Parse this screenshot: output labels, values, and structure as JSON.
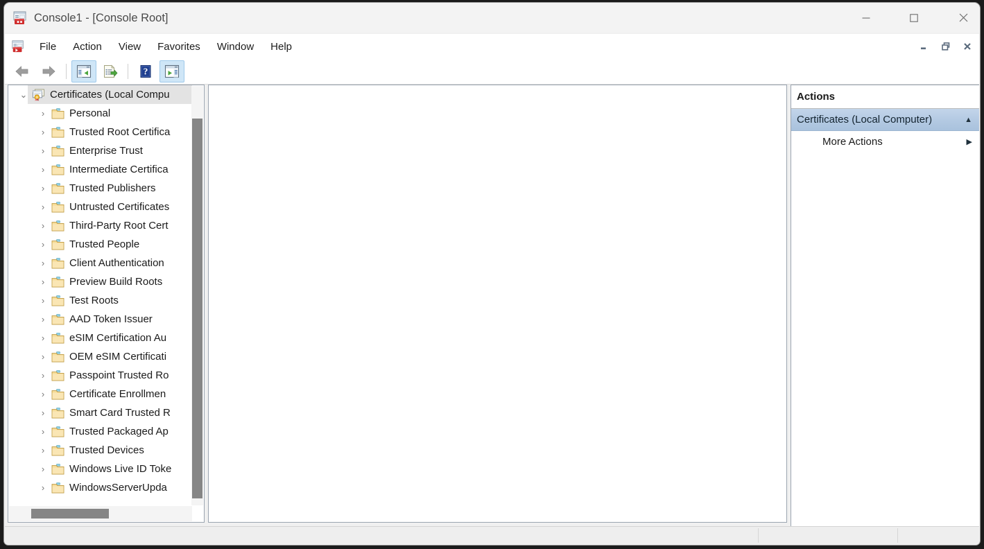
{
  "window": {
    "title": "Console1 - [Console Root]",
    "app_icon": "mmc-console-icon",
    "controls": {
      "minimize": "—",
      "maximize": "☐",
      "close": "✕"
    }
  },
  "menu": {
    "items": [
      {
        "label": "File",
        "name": "menu-file"
      },
      {
        "label": "Action",
        "name": "menu-action"
      },
      {
        "label": "View",
        "name": "menu-view"
      },
      {
        "label": "Favorites",
        "name": "menu-favorites"
      },
      {
        "label": "Window",
        "name": "menu-window"
      },
      {
        "label": "Help",
        "name": "menu-help"
      }
    ],
    "mdi_controls": {
      "minimize": "minimize-child-icon",
      "restore": "restore-child-icon",
      "close": "close-child-icon"
    }
  },
  "toolbar": {
    "buttons": [
      {
        "name": "back-button",
        "icon": "back-arrow-icon",
        "toggled": false
      },
      {
        "name": "forward-button",
        "icon": "forward-arrow-icon",
        "toggled": false
      },
      {
        "name": "show-hide-console-tree-button",
        "icon": "console-tree-icon",
        "toggled": true
      },
      {
        "name": "export-list-button",
        "icon": "export-list-icon",
        "toggled": false
      },
      {
        "name": "help-button",
        "icon": "help-question-icon",
        "toggled": false
      },
      {
        "name": "show-hide-action-pane-button",
        "icon": "action-pane-icon",
        "toggled": true
      }
    ]
  },
  "tree": {
    "root": {
      "label": "Certificates (Local Compu",
      "icon": "certificate-store-icon",
      "expanded": true,
      "selected": true,
      "twisty": "⌄"
    },
    "children": [
      {
        "label": "Personal",
        "icon": "folder-icon"
      },
      {
        "label": "Trusted Root Certifica",
        "icon": "folder-icon"
      },
      {
        "label": "Enterprise Trust",
        "icon": "folder-icon"
      },
      {
        "label": "Intermediate Certifica",
        "icon": "folder-icon"
      },
      {
        "label": "Trusted Publishers",
        "icon": "folder-icon"
      },
      {
        "label": "Untrusted Certificates",
        "icon": "folder-icon"
      },
      {
        "label": "Third-Party Root Cert",
        "icon": "folder-icon"
      },
      {
        "label": "Trusted People",
        "icon": "folder-icon"
      },
      {
        "label": "Client Authentication",
        "icon": "folder-icon"
      },
      {
        "label": "Preview Build Roots",
        "icon": "folder-icon"
      },
      {
        "label": "Test Roots",
        "icon": "folder-icon"
      },
      {
        "label": "AAD Token Issuer",
        "icon": "folder-icon"
      },
      {
        "label": "eSIM Certification Au",
        "icon": "folder-icon"
      },
      {
        "label": "OEM eSIM Certificati",
        "icon": "folder-icon"
      },
      {
        "label": "Passpoint Trusted Ro",
        "icon": "folder-icon"
      },
      {
        "label": "Certificate Enrollmen",
        "icon": "folder-icon"
      },
      {
        "label": "Smart Card Trusted R",
        "icon": "folder-icon"
      },
      {
        "label": "Trusted Packaged Ap",
        "icon": "folder-icon"
      },
      {
        "label": "Trusted Devices",
        "icon": "folder-icon"
      },
      {
        "label": "Windows Live ID Toke",
        "icon": "folder-icon"
      },
      {
        "label": "WindowsServerUpda",
        "icon": "folder-icon"
      }
    ],
    "child_twisty": "›"
  },
  "result_pane": {
    "content": ""
  },
  "actions": {
    "title": "Actions",
    "group": {
      "label": "Certificates (Local Computer)",
      "collapse_chevron": "▲",
      "selected": true
    },
    "items": [
      {
        "label": "More Actions",
        "submenu_arrow": "▶",
        "name": "action-more-actions"
      }
    ]
  },
  "status_bar": {
    "cells": [
      "",
      "",
      ""
    ]
  },
  "colors": {
    "window_chrome": "#f3f3f3",
    "menu_bg": "#ffffff",
    "pane_border": "#9aa4b0",
    "tree_selection": "#e3e3e3",
    "actions_header_gradient_top": "#c3d5ea",
    "actions_header_gradient_bottom": "#a9c2dd",
    "toolbar_toggled": "#cfe6f7",
    "scrollbar_thumb": "#868686",
    "folder_yellow": "#f5d98b",
    "folder_tab_cyan": "#79c8e0",
    "status_bar_bg": "#eeeeee"
  }
}
